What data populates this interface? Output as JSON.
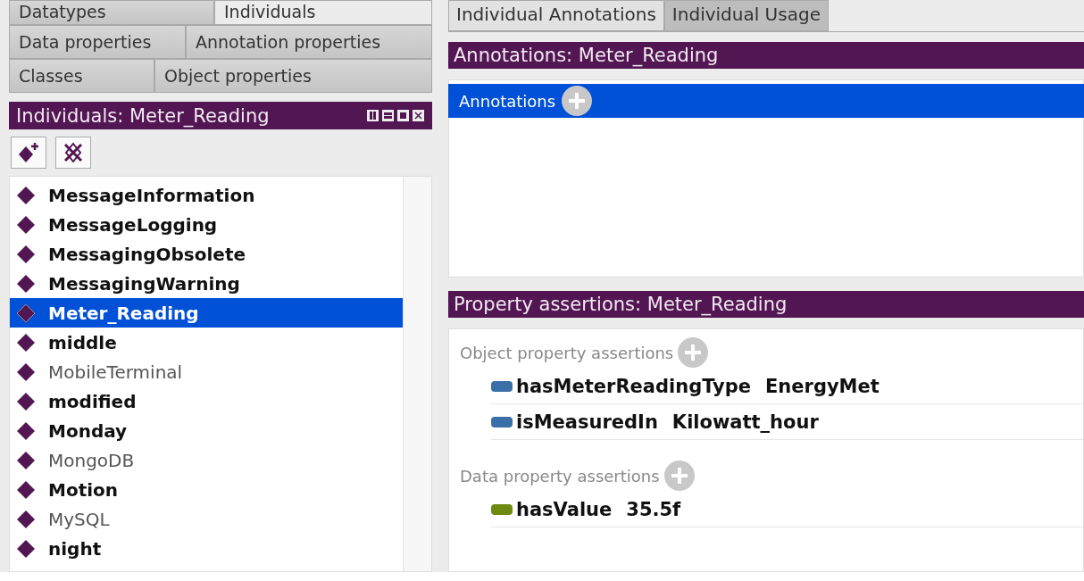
{
  "left": {
    "tab_rows": [
      [
        {
          "label": "Datatypes",
          "selected": false
        },
        {
          "label": "Individuals",
          "selected": true
        }
      ],
      [
        {
          "label": "Data properties",
          "selected": false
        },
        {
          "label": "Annotation properties",
          "selected": false
        }
      ],
      [
        {
          "label": "Classes",
          "selected": false
        },
        {
          "label": "Object properties",
          "selected": false
        }
      ]
    ],
    "view_title": "Individuals: Meter_Reading",
    "individuals": [
      {
        "name": "MessageInformation",
        "bold": true,
        "selected": false
      },
      {
        "name": "MessageLogging",
        "bold": true,
        "selected": false
      },
      {
        "name": "MessagingObsolete",
        "bold": true,
        "selected": false
      },
      {
        "name": "MessagingWarning",
        "bold": true,
        "selected": false
      },
      {
        "name": "Meter_Reading",
        "bold": true,
        "selected": true
      },
      {
        "name": "middle",
        "bold": true,
        "selected": false
      },
      {
        "name": "MobileTerminal",
        "bold": false,
        "selected": false
      },
      {
        "name": "modified",
        "bold": true,
        "selected": false
      },
      {
        "name": "Monday",
        "bold": true,
        "selected": false
      },
      {
        "name": "MongoDB",
        "bold": false,
        "selected": false
      },
      {
        "name": "Motion",
        "bold": true,
        "selected": false
      },
      {
        "name": "MySQL",
        "bold": false,
        "selected": false
      },
      {
        "name": "night",
        "bold": true,
        "selected": false
      }
    ]
  },
  "right": {
    "tabs": [
      {
        "label": "Individual Annotations",
        "selected": true
      },
      {
        "label": "Individual Usage",
        "selected": false
      }
    ],
    "annotations_title": "Annotations: Meter_Reading",
    "annotations_header": "Annotations",
    "assertions_title": "Property assertions: Meter_Reading",
    "sections": [
      {
        "heading": "Object property assertions",
        "items": [
          {
            "property": "hasMeterReadingType",
            "value": "EnergyMet",
            "color": "#3b6fa8"
          },
          {
            "property": "isMeasuredIn",
            "value": "Kilowatt_hour",
            "color": "#3b6fa8"
          }
        ]
      },
      {
        "heading": "Data property assertions",
        "items": [
          {
            "property": "hasValue",
            "value": "35.5f",
            "color": "#6e8a12"
          }
        ]
      }
    ]
  }
}
